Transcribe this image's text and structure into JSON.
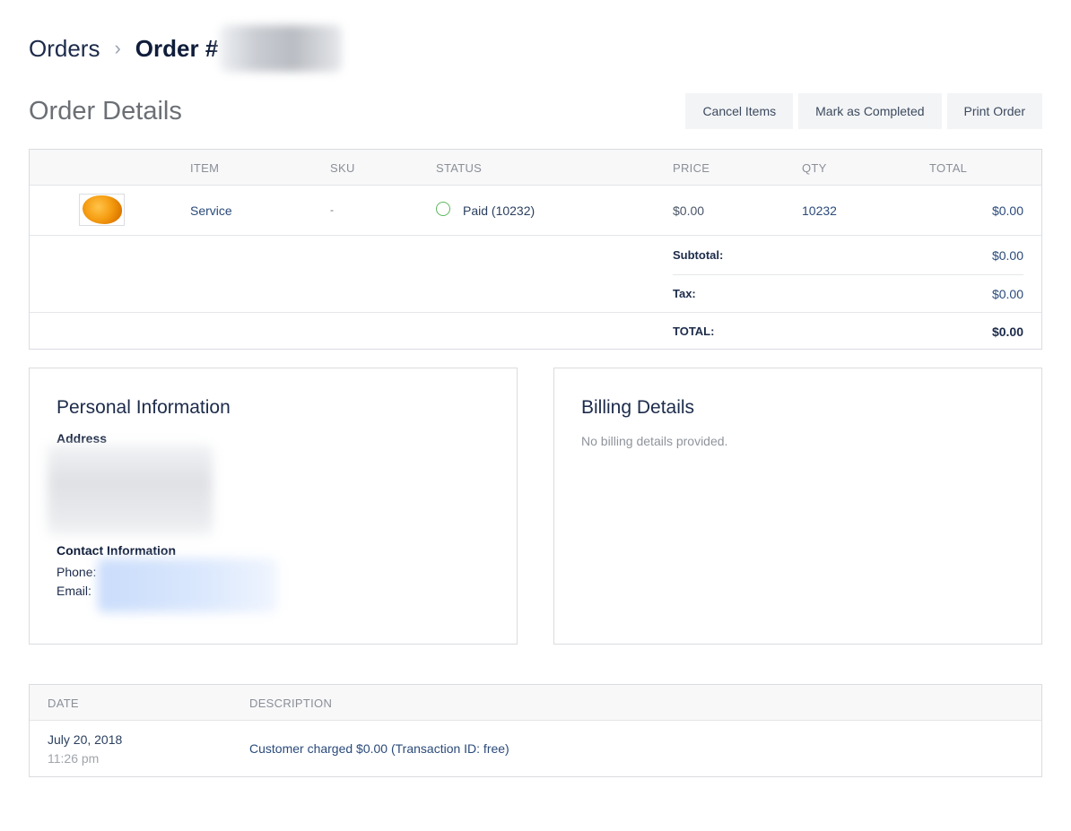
{
  "breadcrumb": {
    "parent": "Orders",
    "separator": "›",
    "current": "Order #"
  },
  "page_title": "Order Details",
  "actions": {
    "cancel": "Cancel Items",
    "complete": "Mark as Completed",
    "print": "Print Order"
  },
  "items_table": {
    "headers": {
      "item": "ITEM",
      "sku": "SKU",
      "status": "STATUS",
      "price": "PRICE",
      "qty": "QTY",
      "total": "TOTAL"
    },
    "rows": [
      {
        "item": "Service",
        "sku": "-",
        "status": "Paid (10232)",
        "price": "$0.00",
        "qty": "10232",
        "total": "$0.00"
      }
    ],
    "summary": {
      "subtotal_label": "Subtotal:",
      "subtotal_value": "$0.00",
      "tax_label": "Tax:",
      "tax_value": "$0.00",
      "total_label": "TOTAL:",
      "total_value": "$0.00"
    }
  },
  "personal": {
    "title": "Personal Information",
    "address_label": "Address",
    "contact_label": "Contact Information",
    "phone_label": "Phone:",
    "email_label": "Email:"
  },
  "billing": {
    "title": "Billing Details",
    "empty_text": "No billing details provided."
  },
  "history": {
    "headers": {
      "date": "DATE",
      "description": "DESCRIPTION"
    },
    "rows": [
      {
        "date": "July 20, 2018",
        "time": "11:26 pm",
        "description": "Customer charged $0.00 (Transaction ID: free)"
      }
    ]
  },
  "colors": {
    "paid_status": "#5cb85c",
    "text_primary": "#1c2b4a",
    "muted": "#8a8f97"
  }
}
